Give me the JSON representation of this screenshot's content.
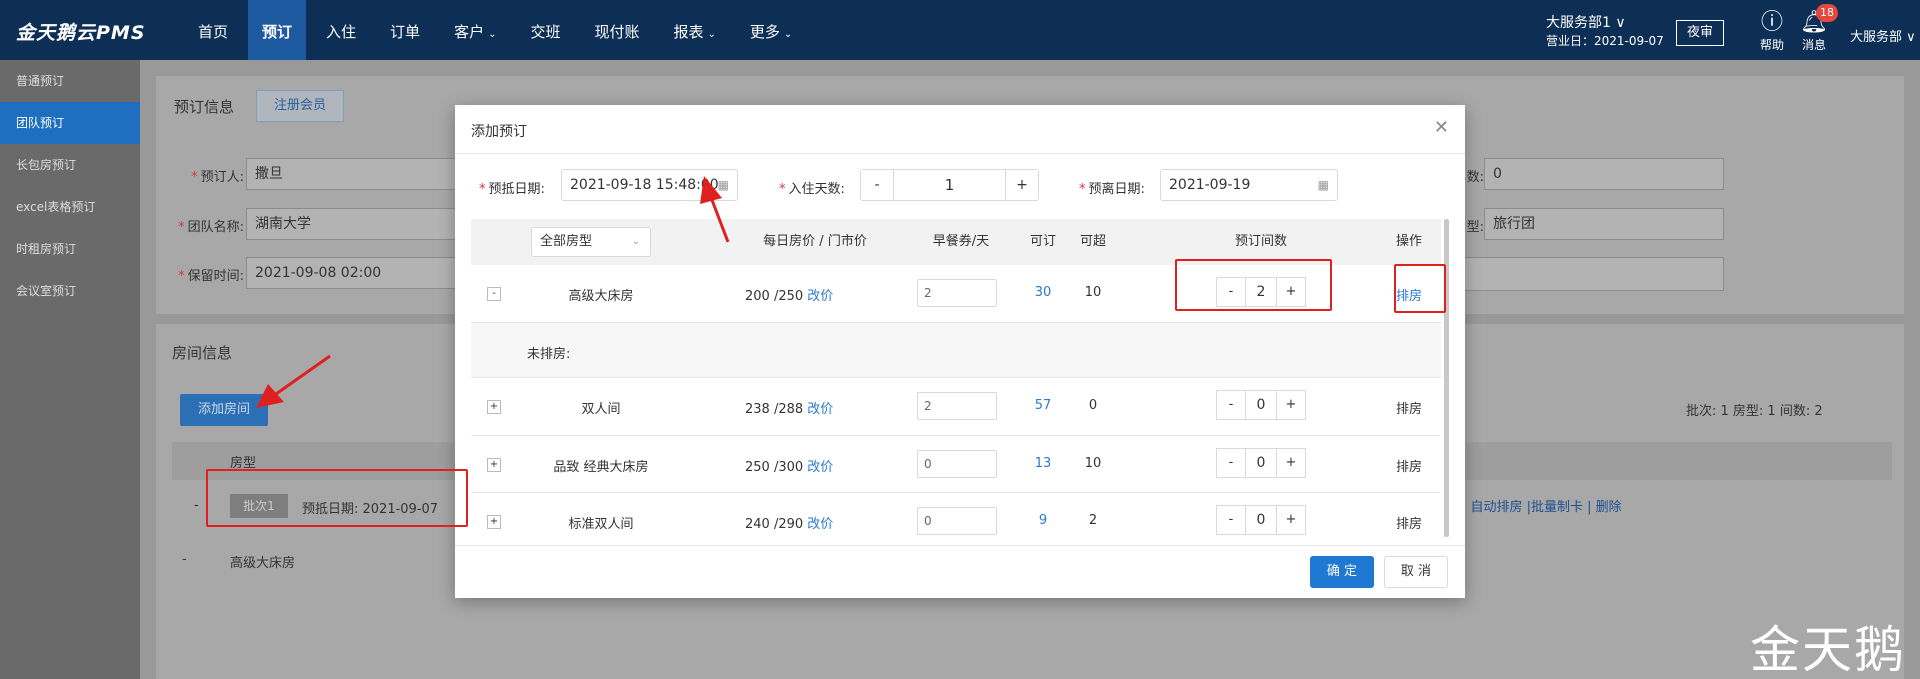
{
  "header": {
    "brand": "金天鹅云PMS",
    "nav": [
      {
        "label": "首页",
        "dropdown": false,
        "active": false
      },
      {
        "label": "预订",
        "dropdown": false,
        "active": true
      },
      {
        "label": "入住",
        "dropdown": false,
        "active": false
      },
      {
        "label": "订单",
        "dropdown": false,
        "active": false
      },
      {
        "label": "客户",
        "dropdown": true,
        "active": false
      },
      {
        "label": "交班",
        "dropdown": false,
        "active": false
      },
      {
        "label": "现付账",
        "dropdown": false,
        "active": false
      },
      {
        "label": "报表",
        "dropdown": true,
        "active": false
      },
      {
        "label": "更多",
        "dropdown": true,
        "active": false
      }
    ],
    "shop_name": "大服务部1 ∨",
    "business_date": "营业日：2021-09-07",
    "night_audit": "夜审",
    "help": {
      "label": "帮助",
      "icon": "question-circle-icon"
    },
    "messages": {
      "label": "消息",
      "icon": "bell-icon",
      "count": "18"
    },
    "user": "大服务部 ∨"
  },
  "sidebar": {
    "items": [
      {
        "label": "普通预订",
        "active": false
      },
      {
        "label": "团队预订",
        "active": true
      },
      {
        "label": "长包房预订",
        "active": false
      },
      {
        "label": "excel表格预订",
        "active": false
      },
      {
        "label": "时租房预订",
        "active": false
      },
      {
        "label": "会议室预订",
        "active": false
      }
    ]
  },
  "booking_info": {
    "title": "预订信息",
    "register_member": "注册会员",
    "booker_label": "预订人:",
    "booker_value": "撒旦",
    "team_label": "团队名称:",
    "team_value": "湖南大学",
    "hold_label": "保留时间:",
    "hold_value": "2021-09-08 02:00",
    "right_label_1": "数:",
    "right_value_1": "0",
    "right_label_2": "型:",
    "right_value_2": "旅行团"
  },
  "room_info": {
    "title": "房间信息",
    "add_room": "添加房间",
    "stats": "批次:  1    房型:  1    间数:  2",
    "col_room_type": "房型",
    "batch_tag": "批次1",
    "batch_arrival": "预抵日期:  2021-09-07",
    "room_row": "高级大床房",
    "links": "| 自动排房  |批量制卡 | 删除"
  },
  "modal": {
    "title": "添加预订",
    "arrival_label": "预抵日期:",
    "arrival_value": "2021-09-18 15:48:00",
    "nights_label": "入住天数:",
    "nights_value": "1",
    "departure_label": "预离日期:",
    "departure_value": "2021-09-19",
    "room_type_select": "全部房型",
    "headers": {
      "price": "每日房价 / 门市价",
      "breakfast": "早餐券/天",
      "available": "可订",
      "overbook": "可超",
      "rooms": "预订间数",
      "action": "操作"
    },
    "rows": [
      {
        "expand": "-",
        "name": "高级大床房",
        "price": "200 /250",
        "change_price": "改价",
        "breakfast": "2",
        "available": "30",
        "overbook": "10",
        "rooms": "2",
        "action": "排房"
      },
      {
        "expand": "+",
        "name": "双人间",
        "price": "238 /288",
        "change_price": "改价",
        "breakfast": "2",
        "available": "57",
        "overbook": "0",
        "rooms": "0",
        "action": "排房"
      },
      {
        "expand": "+",
        "name": "品致 经典大床房",
        "price": "250 /300",
        "change_price": "改价",
        "breakfast": "0",
        "available": "13",
        "overbook": "10",
        "rooms": "0",
        "action": "排房"
      },
      {
        "expand": "+",
        "name": "标准双人间",
        "price": "240 /290",
        "change_price": "改价",
        "breakfast": "0",
        "available": "9",
        "overbook": "2",
        "rooms": "0",
        "action": "排房"
      }
    ],
    "unassigned_label": "未排房:",
    "confirm": "确 定",
    "cancel": "取 消"
  },
  "watermark": "金天鹅",
  "colors": {
    "topbar": "#0e2f55",
    "active_nav": "#1e5aa0",
    "primary": "#1f78d1",
    "annotation": "#e02020"
  }
}
